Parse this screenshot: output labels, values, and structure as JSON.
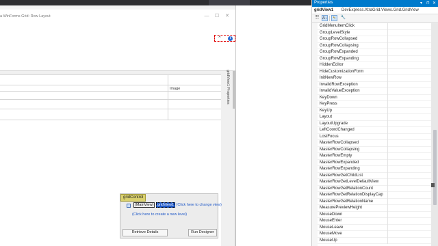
{
  "form": {
    "title": "a WinForms Grid: Row Layout",
    "min_glyph": "—",
    "max_glyph": "☐",
    "close_glyph": "✕",
    "chevron_glyph": "⌃",
    "help_glyph": "i"
  },
  "grid": {
    "image_column_header": "Image"
  },
  "side_tab": {
    "label": "gridView1 Properties"
  },
  "level_designer": {
    "tag": "gridControl",
    "node_view": "(MainView)",
    "node_selected": "gridView1",
    "node_link": "(Click here to change view)",
    "create_level": "(Click here to create a new level)",
    "retrieve_details": "Retrieve Details",
    "run_designer": "Run Designer"
  },
  "properties": {
    "title": "Properties",
    "object_name": "gridView1",
    "object_type": "DevExpress.XtraGrid.Views.Grid.GridView",
    "pin_dropdown_glyph": "▾",
    "pin_glyph": "⊓",
    "close_glyph": "✕",
    "toolbar": {
      "categorized_glyph": "☷",
      "alphabetical_glyph": "A↓",
      "events_glyph": "ϟ",
      "wrench_glyph": "🔧"
    },
    "scroll_position": 0.72,
    "events": [
      "GridMenuItemClick",
      "GroupLevelStyle",
      "GroupRowCollapsed",
      "GroupRowCollapsing",
      "GroupRowExpanded",
      "GroupRowExpanding",
      "HiddenEditor",
      "HideCustomizationForm",
      "InitNewRow",
      "InvalidRowException",
      "InvalidValueException",
      "KeyDown",
      "KeyPress",
      "KeyUp",
      "Layout",
      "LayoutUpgrade",
      "LeftCoordChanged",
      "LostFocus",
      "MasterRowCollapsed",
      "MasterRowCollapsing",
      "MasterRowEmpty",
      "MasterRowExpanded",
      "MasterRowExpanding",
      "MasterRowGetChildList",
      "MasterRowGetLevelDefaultView",
      "MasterRowGetRelationCount",
      "MasterRowGetRelationDisplayCap",
      "MasterRowGetRelationName",
      "MeasurePreviewHeight",
      "MouseDown",
      "MouseEnter",
      "MouseLeave",
      "MouseMove",
      "MouseUp"
    ]
  }
}
